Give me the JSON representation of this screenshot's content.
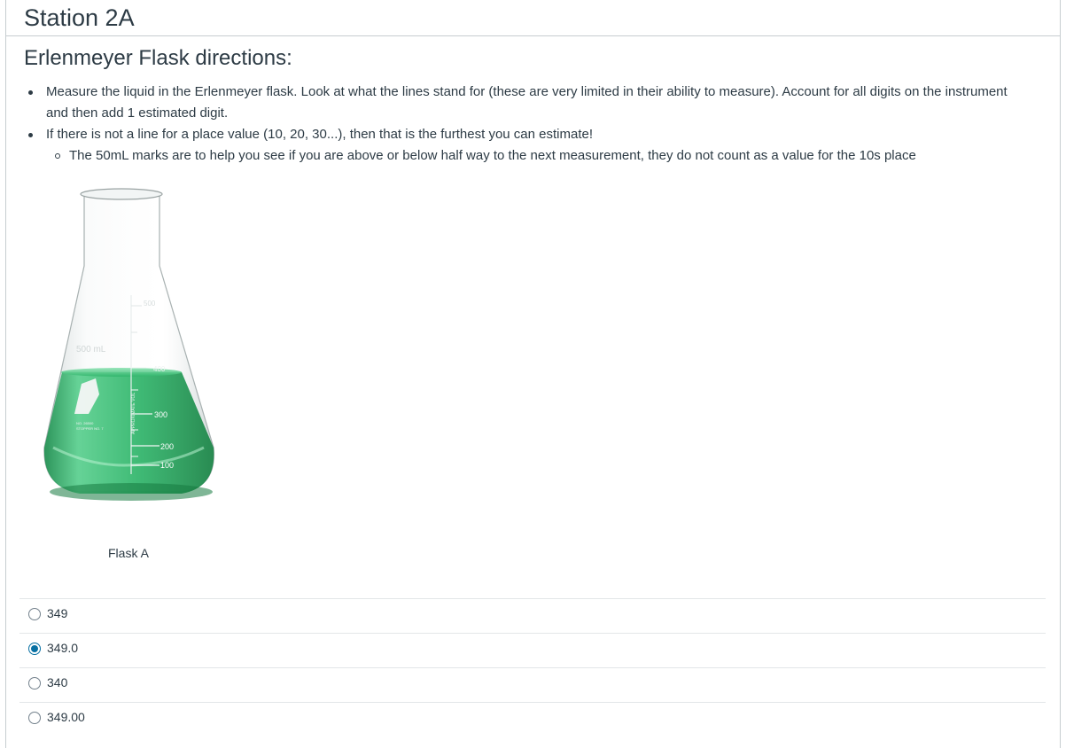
{
  "station": {
    "title": "Station 2A"
  },
  "directions": {
    "heading": "Erlenmeyer Flask directions:",
    "bullets": [
      "Measure the liquid in the Erlenmeyer flask. Look at what the lines stand for (these are very limited in their ability to measure). Account for all digits on the instrument and then add 1 estimated digit.",
      "If there is not a line for a place value (10, 20, 30...), then that is the furthest you can estimate!"
    ],
    "sub_bullets": [
      "The 50mL marks are to help you see if you are above or below half way to the next measurement, they do not count as a value for the 10s place"
    ]
  },
  "figure": {
    "caption": "Flask A",
    "flask_labels": {
      "capacity": "500 mL",
      "approx": "APPROXIMATE VOL",
      "mark_500": "500",
      "mark_400": "400",
      "mark_300": "300",
      "mark_200": "200",
      "mark_100": "100",
      "stopper": "STOPPER NO. 7",
      "code": "NO. 26500"
    },
    "liquid_color": "#2fb56a"
  },
  "answers": {
    "selected_index": 1,
    "options": [
      "349",
      "349.0",
      "340",
      "349.00"
    ]
  },
  "colors": {
    "text": "#2d3b45",
    "rule": "#c7cdd1",
    "radio_selected": "#0770a3"
  }
}
